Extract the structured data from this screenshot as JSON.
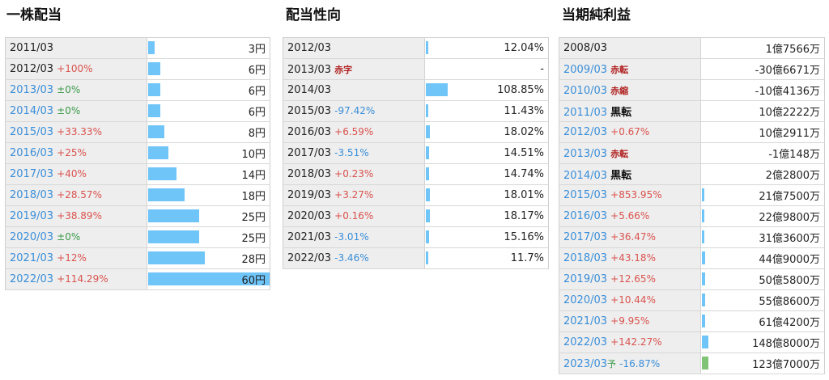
{
  "panels": [
    {
      "title": "一株配当",
      "rows": [
        {
          "period": "2011/03",
          "change": "",
          "change_style": "",
          "value": "3円",
          "bar": 0.05,
          "link": false
        },
        {
          "period": "2012/03",
          "change": "+100%",
          "change_style": "up",
          "value": "6円",
          "bar": 0.1,
          "link": false
        },
        {
          "period": "2013/03",
          "change": "±0%",
          "change_style": "flat",
          "value": "6円",
          "bar": 0.1,
          "link": true
        },
        {
          "period": "2014/03",
          "change": "±0%",
          "change_style": "flat",
          "value": "6円",
          "bar": 0.1,
          "link": true
        },
        {
          "period": "2015/03",
          "change": "+33.33%",
          "change_style": "up",
          "value": "8円",
          "bar": 0.133,
          "link": true
        },
        {
          "period": "2016/03",
          "change": "+25%",
          "change_style": "up",
          "value": "10円",
          "bar": 0.167,
          "link": true
        },
        {
          "period": "2017/03",
          "change": "+40%",
          "change_style": "up",
          "value": "14円",
          "bar": 0.233,
          "link": true
        },
        {
          "period": "2018/03",
          "change": "+28.57%",
          "change_style": "up",
          "value": "18円",
          "bar": 0.3,
          "link": true
        },
        {
          "period": "2019/03",
          "change": "+38.89%",
          "change_style": "up",
          "value": "25円",
          "bar": 0.417,
          "link": true
        },
        {
          "period": "2020/03",
          "change": "±0%",
          "change_style": "flat",
          "value": "25円",
          "bar": 0.417,
          "link": true
        },
        {
          "period": "2021/03",
          "change": "+12%",
          "change_style": "up",
          "value": "28円",
          "bar": 0.467,
          "link": true
        },
        {
          "period": "2022/03",
          "change": "+114.29%",
          "change_style": "up",
          "value": "60円",
          "bar": 1.0,
          "link": true
        }
      ]
    },
    {
      "title": "配当性向",
      "rows": [
        {
          "period": "2012/03",
          "change": "",
          "change_style": "",
          "value": "12.04%",
          "bar": 0.02,
          "link": false
        },
        {
          "period": "2013/03",
          "change": "赤字",
          "change_style": "tag-red",
          "value": "-",
          "bar": 0,
          "link": false
        },
        {
          "period": "2014/03",
          "change": "",
          "change_style": "",
          "value": "108.85%",
          "bar": 0.18,
          "link": false
        },
        {
          "period": "2015/03",
          "change": "-97.42%",
          "change_style": "down",
          "value": "11.43%",
          "bar": 0.02,
          "link": false
        },
        {
          "period": "2016/03",
          "change": "+6.59%",
          "change_style": "up",
          "value": "18.02%",
          "bar": 0.03,
          "link": false
        },
        {
          "period": "2017/03",
          "change": "-3.51%",
          "change_style": "down",
          "value": "14.51%",
          "bar": 0.025,
          "link": false
        },
        {
          "period": "2018/03",
          "change": "+0.23%",
          "change_style": "up",
          "value": "14.74%",
          "bar": 0.025,
          "link": false
        },
        {
          "period": "2019/03",
          "change": "+3.27%",
          "change_style": "up",
          "value": "18.01%",
          "bar": 0.03,
          "link": false
        },
        {
          "period": "2020/03",
          "change": "+0.16%",
          "change_style": "up",
          "value": "18.17%",
          "bar": 0.03,
          "link": false
        },
        {
          "period": "2021/03",
          "change": "-3.01%",
          "change_style": "down",
          "value": "15.16%",
          "bar": 0.025,
          "link": false
        },
        {
          "period": "2022/03",
          "change": "-3.46%",
          "change_style": "down",
          "value": "11.7%",
          "bar": 0.02,
          "link": false
        }
      ]
    },
    {
      "title": "当期純利益",
      "rows": [
        {
          "period": "2008/03",
          "change": "",
          "change_style": "",
          "value": "1億7566万",
          "bar": 0,
          "link": false
        },
        {
          "period": "2009/03",
          "change": "赤転",
          "change_style": "tag-red",
          "value": "-30億6671万",
          "bar": 0,
          "link": true
        },
        {
          "period": "2010/03",
          "change": "赤縮",
          "change_style": "tag-red",
          "value": "-10億4136万",
          "bar": 0,
          "link": true
        },
        {
          "period": "2011/03",
          "change": "黒転",
          "change_style": "tag-black",
          "value": "10億2222万",
          "bar": 0,
          "link": true
        },
        {
          "period": "2012/03",
          "change": "+0.67%",
          "change_style": "up",
          "value": "10億2911万",
          "bar": 0,
          "link": true
        },
        {
          "period": "2013/03",
          "change": "赤転",
          "change_style": "tag-red",
          "value": "-1億148万",
          "bar": 0,
          "link": true
        },
        {
          "period": "2014/03",
          "change": "黒転",
          "change_style": "tag-black",
          "value": "2億2800万",
          "bar": 0,
          "link": true
        },
        {
          "period": "2015/03",
          "change": "+853.95%",
          "change_style": "up",
          "value": "21億7500万",
          "bar": 0.02,
          "link": true
        },
        {
          "period": "2016/03",
          "change": "+5.66%",
          "change_style": "up",
          "value": "22億9800万",
          "bar": 0.02,
          "link": true
        },
        {
          "period": "2017/03",
          "change": "+36.47%",
          "change_style": "up",
          "value": "31億3600万",
          "bar": 0.02,
          "link": true
        },
        {
          "period": "2018/03",
          "change": "+43.18%",
          "change_style": "up",
          "value": "44億9000万",
          "bar": 0.025,
          "link": true
        },
        {
          "period": "2019/03",
          "change": "+12.65%",
          "change_style": "up",
          "value": "50億5800万",
          "bar": 0.025,
          "link": true
        },
        {
          "period": "2020/03",
          "change": "+10.44%",
          "change_style": "up",
          "value": "55億8600万",
          "bar": 0.025,
          "link": true
        },
        {
          "period": "2021/03",
          "change": "+9.95%",
          "change_style": "up",
          "value": "61億4200万",
          "bar": 0.025,
          "link": true
        },
        {
          "period": "2022/03",
          "change": "+142.27%",
          "change_style": "up",
          "value": "148億8000万",
          "bar": 0.05,
          "link": true
        },
        {
          "period": "2023/03",
          "forecast": "予",
          "change": "-16.87%",
          "change_style": "down",
          "value": "123億7000万",
          "bar": 0.05,
          "link": true,
          "bar_color": "green"
        }
      ]
    }
  ]
}
